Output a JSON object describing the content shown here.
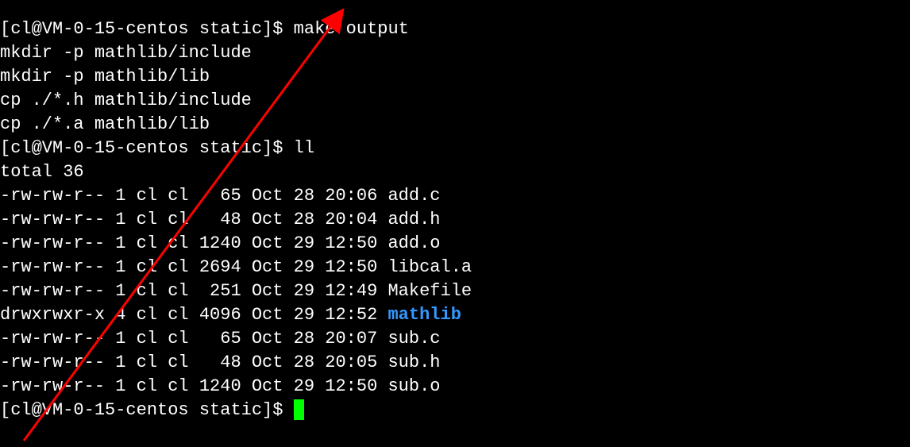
{
  "prompt": "[cl@VM-0-15-centos static]$ ",
  "commands": {
    "cmd0": "make output",
    "cmd1": "ll"
  },
  "make_output": [
    "mkdir -p mathlib/include",
    "mkdir -p mathlib/lib",
    "cp ./*.h mathlib/include",
    "cp ./*.a mathlib/lib"
  ],
  "ll_total": "total 36",
  "ls": [
    {
      "perm": "-rw-rw-r--",
      "links": "1",
      "owner": "cl",
      "group": "cl",
      "size": "  65",
      "date": "Oct 28 20:06",
      "name": "add.c",
      "dir": false
    },
    {
      "perm": "-rw-rw-r--",
      "links": "1",
      "owner": "cl",
      "group": "cl",
      "size": "  48",
      "date": "Oct 28 20:04",
      "name": "add.h",
      "dir": false
    },
    {
      "perm": "-rw-rw-r--",
      "links": "1",
      "owner": "cl",
      "group": "cl",
      "size": "1240",
      "date": "Oct 29 12:50",
      "name": "add.o",
      "dir": false
    },
    {
      "perm": "-rw-rw-r--",
      "links": "1",
      "owner": "cl",
      "group": "cl",
      "size": "2694",
      "date": "Oct 29 12:50",
      "name": "libcal.a",
      "dir": false
    },
    {
      "perm": "-rw-rw-r--",
      "links": "1",
      "owner": "cl",
      "group": "cl",
      "size": " 251",
      "date": "Oct 29 12:49",
      "name": "Makefile",
      "dir": false
    },
    {
      "perm": "drwxrwxr-x",
      "links": "4",
      "owner": "cl",
      "group": "cl",
      "size": "4096",
      "date": "Oct 29 12:52",
      "name": "mathlib",
      "dir": true
    },
    {
      "perm": "-rw-rw-r--",
      "links": "1",
      "owner": "cl",
      "group": "cl",
      "size": "  65",
      "date": "Oct 28 20:07",
      "name": "sub.c",
      "dir": false
    },
    {
      "perm": "-rw-rw-r--",
      "links": "1",
      "owner": "cl",
      "group": "cl",
      "size": "  48",
      "date": "Oct 28 20:05",
      "name": "sub.h",
      "dir": false
    },
    {
      "perm": "-rw-rw-r--",
      "links": "1",
      "owner": "cl",
      "group": "cl",
      "size": "1240",
      "date": "Oct 29 12:50",
      "name": "sub.o",
      "dir": false
    }
  ]
}
